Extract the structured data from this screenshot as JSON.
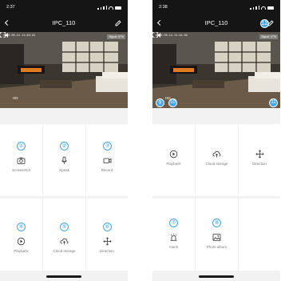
{
  "left": {
    "status_time": "2:37",
    "title": "IPC_110",
    "timestamp": "2020-05-14 11:40:23",
    "signal": "Signal: 47%",
    "hd": "HD",
    "buttons": [
      {
        "num": "①",
        "label": "Screenshot"
      },
      {
        "num": "②",
        "label": "Speak"
      },
      {
        "num": "③",
        "label": "Record"
      },
      {
        "num": "④",
        "label": "Playback"
      },
      {
        "num": "⑤",
        "label": "Cloud storage"
      },
      {
        "num": "⑥",
        "label": "Direction"
      }
    ]
  },
  "right": {
    "status_time": "2:38",
    "title": "IPC_110",
    "timestamp": "2020-05-14 11:41:02",
    "signal": "Signal: 47%",
    "hd": "HD",
    "buttons": [
      {
        "label": "Playback"
      },
      {
        "label": "Cloud storage"
      },
      {
        "label": "Direction"
      },
      {
        "num": "⑦",
        "label": "Alarm"
      },
      {
        "num": "⑧",
        "label": "Photo album"
      }
    ],
    "badges": {
      "speaker": "9",
      "hd": "10",
      "fullscreen": "11",
      "edit": "12"
    }
  },
  "colors": {
    "accent": "#44a6e8",
    "nav_bg": "#151515",
    "page_bg": "#f2f2f2"
  },
  "icons": [
    "camera-icon",
    "microphone-icon",
    "record-icon",
    "playback-icon",
    "cloud-icon",
    "direction-icon",
    "alarm-icon",
    "photo-album-icon",
    "speaker-icon",
    "fullscreen-icon",
    "edit-icon",
    "back-icon"
  ]
}
